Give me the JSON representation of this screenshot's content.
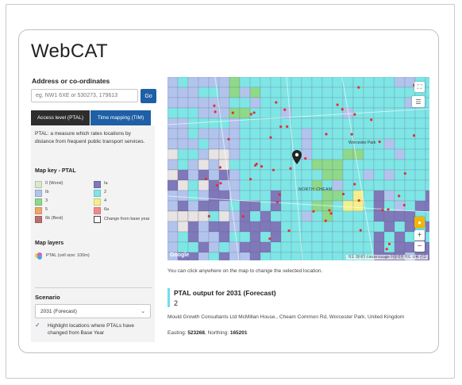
{
  "app": {
    "title": "WebCAT"
  },
  "search": {
    "label": "Address or co-ordinates",
    "placeholder": "eg. NW1 6XE or 530273, 179613",
    "go_label": "Go"
  },
  "tabs": [
    {
      "label": "Access level (PTAL)",
      "active": true
    },
    {
      "label": "Time mapping (TIM)",
      "active": false
    }
  ],
  "ptal": {
    "description": "PTAL: a measure which rates locations by distance from frequent public transport services."
  },
  "map_key": {
    "title": "Map key - PTAL",
    "items": [
      {
        "label": "0 (Worst)",
        "color": "#d8e8c8"
      },
      {
        "label": "Ia",
        "color": "#7f79b9"
      },
      {
        "label": "Ib",
        "color": "#b2c4ec"
      },
      {
        "label": "2",
        "color": "#7fe5e5"
      },
      {
        "label": "3",
        "color": "#8ed98a"
      },
      {
        "label": "4",
        "color": "#f3f08a"
      },
      {
        "label": "5",
        "color": "#f1a56b"
      },
      {
        "label": "6a",
        "color": "#f08a8a"
      },
      {
        "label": "6b (Best)",
        "color": "#b97070"
      },
      {
        "label": "Change from base year",
        "color": "#ffffff"
      }
    ]
  },
  "map_layers": {
    "title": "Map layers",
    "items": [
      {
        "label": "PTAL (cell size: 100m)",
        "icon": "ptal-layer-icon"
      }
    ]
  },
  "scenario": {
    "title": "Scenario",
    "selected": "2031 (Forecast)",
    "checkbox_label": "Highlight locations where PTALs have changed from Base Year",
    "checked": true
  },
  "map": {
    "labels": {
      "worcester_park": "Worcester Park",
      "north_cheam": "NORTH CHEAM"
    },
    "google": "Google",
    "attribution": "지도 데이터 ©2018 Google   이용약관  지도 오류 신고",
    "zoom_in": "+",
    "zoom_out": "−"
  },
  "caption": "You can click anywhere on the map to change the selected location.",
  "output": {
    "title": "PTAL output for 2031 (Forecast)",
    "value": "2",
    "address": "Mould Growth Consultants Ltd McMillan House., Cheam Common Rd, Worcester Park, United Kingdom",
    "easting_label": "Easting:",
    "easting": "523268",
    "northing_label": "Northing:",
    "northing": "165201"
  }
}
